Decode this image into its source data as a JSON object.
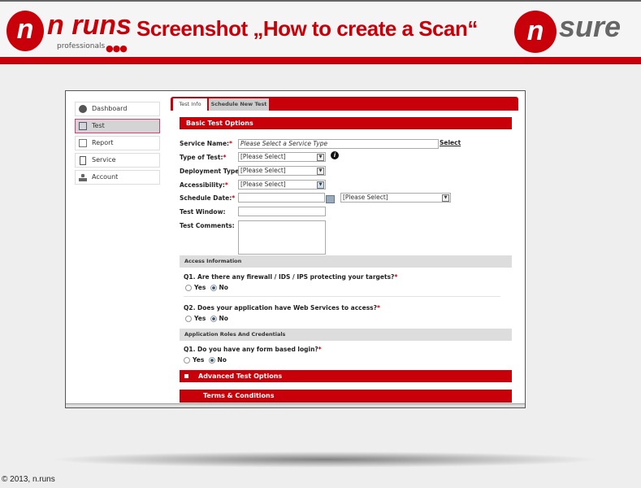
{
  "header": {
    "title": "Screenshot „How to create a Scan“",
    "logo_left": "n runs",
    "logo_left_sub": "professionals",
    "logo_right": "n sure"
  },
  "sidebar": {
    "items": [
      {
        "label": "Dashboard"
      },
      {
        "label": "Test"
      },
      {
        "label": "Report"
      },
      {
        "label": "Service"
      },
      {
        "label": "Account"
      }
    ]
  },
  "tabs": [
    {
      "label": "Test Info"
    },
    {
      "label": "Schedule New Test"
    }
  ],
  "form": {
    "section": "Basic Test Options",
    "service_name": {
      "label": "Service Name:",
      "value": "Please Select a Service Type",
      "link": "Select"
    },
    "type_of_test": {
      "label": "Type of Test:",
      "value": "[Please Select]"
    },
    "deployment_type": {
      "label": "Deployment Type:",
      "value": "[Please Select]"
    },
    "accessibility": {
      "label": "Accessibility:",
      "value": "[Please Select]"
    },
    "schedule_date": {
      "label": "Schedule Date:",
      "value": "",
      "select": "[Please Select]"
    },
    "test_window": {
      "label": "Test Window:",
      "value": ""
    },
    "test_comments": {
      "label": "Test Comments:",
      "value": ""
    },
    "required_mark": "*"
  },
  "access": {
    "title": "Access Information",
    "q1": "Q1. Are there any firewall / IDS / IPS protecting your targets?",
    "q2": "Q2. Does your application have Web Services to access?"
  },
  "roles": {
    "title": "Application Roles And Credentials",
    "q1": "Q1. Do you have any form based login?"
  },
  "radio": {
    "yes": "Yes",
    "no": "No"
  },
  "advanced": "Advanced Test Options",
  "terms": "Terms & Conditions",
  "footer": "© 2013, n.runs"
}
